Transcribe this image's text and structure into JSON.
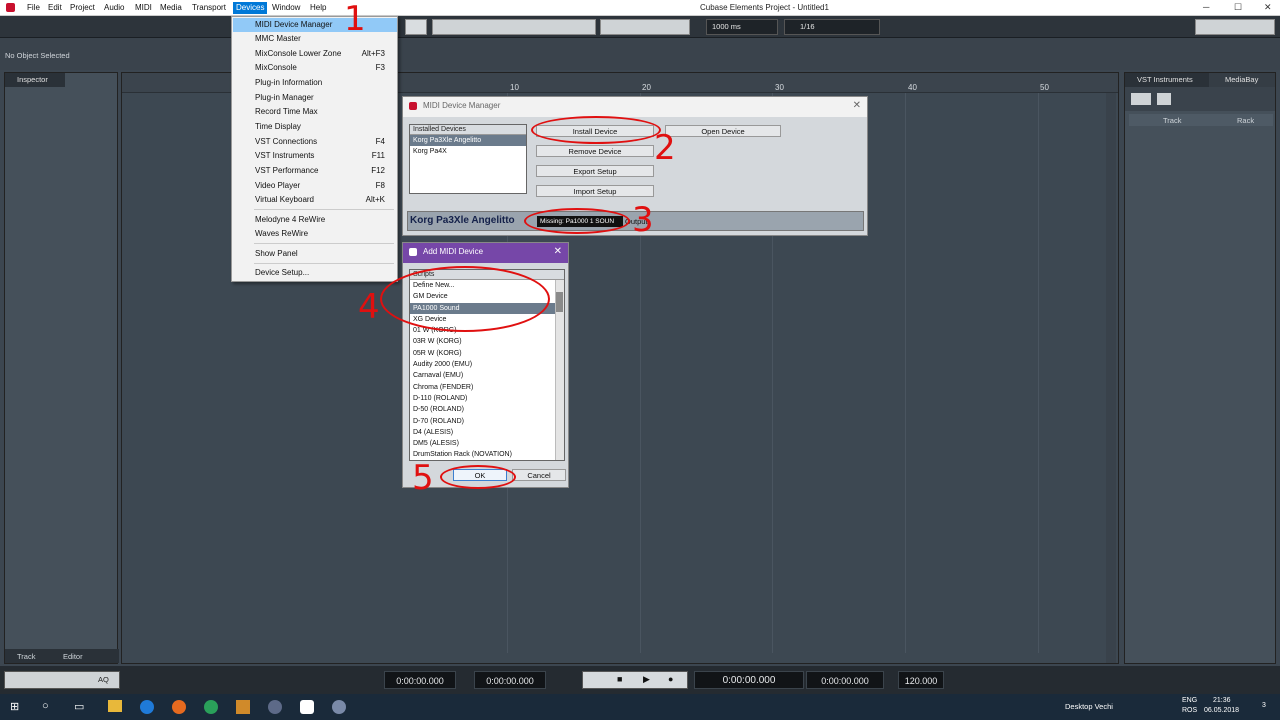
{
  "menubar": {
    "items": [
      "File",
      "Edit",
      "Project",
      "Audio",
      "MIDI",
      "Media",
      "Transport",
      "Devices",
      "Window",
      "Help"
    ],
    "active": "Devices",
    "app_title": "Cubase Elements Project - Untitled1"
  },
  "toolbar": {
    "time_value": "1000 ms",
    "quantize": "1/16"
  },
  "status": {
    "no_object": "No Object Selected"
  },
  "inspector": {
    "tab": "Inspector",
    "bottom_tabs": [
      "Track",
      "Editor"
    ]
  },
  "ruler": {
    "numbers": [
      "10",
      "20",
      "30",
      "40",
      "50"
    ]
  },
  "vst_panel": {
    "tabs": [
      "VST Instruments",
      "MediaBay"
    ],
    "columns": [
      "Track",
      "Rack"
    ]
  },
  "devices_menu": {
    "items": [
      {
        "label": "MIDI Device Manager",
        "shortcut": ""
      },
      {
        "label": "MMC Master",
        "shortcut": ""
      },
      {
        "label": "MixConsole Lower Zone",
        "shortcut": "Alt+F3"
      },
      {
        "label": "MixConsole",
        "shortcut": "F3"
      },
      {
        "label": "Plug-in Information",
        "shortcut": ""
      },
      {
        "label": "Plug-in Manager",
        "shortcut": ""
      },
      {
        "label": "Record Time Max",
        "shortcut": ""
      },
      {
        "label": "Time Display",
        "shortcut": ""
      },
      {
        "label": "VST Connections",
        "shortcut": "F4"
      },
      {
        "label": "VST Instruments",
        "shortcut": "F11"
      },
      {
        "label": "VST Performance",
        "shortcut": "F12"
      },
      {
        "label": "Video Player",
        "shortcut": "F8"
      },
      {
        "label": "Virtual Keyboard",
        "shortcut": "Alt+K"
      },
      {
        "label": "Melodyne 4 ReWire",
        "shortcut": ""
      },
      {
        "label": "Waves ReWire",
        "shortcut": ""
      },
      {
        "label": "Show Panel",
        "shortcut": ""
      },
      {
        "label": "Device Setup...",
        "shortcut": ""
      }
    ]
  },
  "midi_device_manager": {
    "title": "MIDI Device Manager",
    "installed_header": "Installed Devices",
    "installed": [
      "Korg Pa3Xle Angelitto",
      "Korg Pa4X"
    ],
    "buttons": {
      "install": "Install Device",
      "remove": "Remove Device",
      "export": "Export Setup",
      "import": "Import Setup",
      "open": "Open Device"
    },
    "selected_device": "Korg Pa3Xle Angelitto",
    "output_value": "Missing: Pa1000 1 SOUN",
    "output_label": "Output"
  },
  "add_midi_device": {
    "title": "Add MIDI Device",
    "header": "Scripts",
    "items": [
      "Define New...",
      "GM Device",
      "PA1000 Sound",
      "XG Device",
      "01 W (KORG)",
      "03R W (KORG)",
      "05R W (KORG)",
      "Audity 2000 (EMU)",
      "Carnaval (EMU)",
      "Chroma (FENDER)",
      "D-110 (ROLAND)",
      "D-50 (ROLAND)",
      "D-70 (ROLAND)",
      "D4 (ALESIS)",
      "DM5 (ALESIS)",
      "DrumStation Rack (NOVATION)"
    ],
    "selected": "PA1000 Sound",
    "ok": "OK",
    "cancel": "Cancel"
  },
  "annotations": [
    "1",
    "2",
    "3",
    "4",
    "5"
  ],
  "transport": {
    "times": [
      "0:00:00.000",
      "0:00:00.000",
      "0:00:00.000",
      "0:00:00.000"
    ],
    "tempo": "120.000",
    "aq": "AQ"
  },
  "taskbar": {
    "desktop": "Desktop Vechi",
    "lang1": "ENG",
    "lang2": "ROS",
    "time": "21:36",
    "date": "06.05.2018",
    "notif": "3"
  }
}
